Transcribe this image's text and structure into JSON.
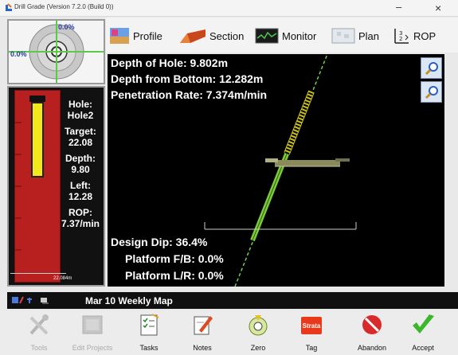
{
  "window": {
    "title": "Drill Grade (Version 7.2.0 (Build 0))",
    "minimize": "–",
    "close": "×"
  },
  "compass": {
    "top_label": "0.0%",
    "left_label": "0.0%"
  },
  "tabs": [
    {
      "label": "Profile",
      "icon": "profile-icon"
    },
    {
      "label": "Section",
      "icon": "section-icon"
    },
    {
      "label": "Monitor",
      "icon": "monitor-icon"
    },
    {
      "label": "Plan",
      "icon": "plan-icon"
    },
    {
      "label": "ROP",
      "icon": "rop-icon"
    }
  ],
  "side_stats": {
    "hole_label": "Hole:",
    "hole_value": "Hole2",
    "target_label": "Target:",
    "target_value": "22.08",
    "depth_label": "Depth:",
    "depth_value": "9.80",
    "left_label": "Left:",
    "left_value": "12.28",
    "rop_label": "ROP:",
    "rop_value": "7.37/min",
    "gauge_depth": "22.084m",
    "gauge_fill": 0.44
  },
  "view": {
    "depth_of_hole": "Depth of Hole: 9.802m",
    "depth_from_bottom": "Depth from Bottom: 12.282m",
    "penetration_rate": "Penetration Rate: 7.374m/min",
    "design_dip": "Design Dip: 36.4%",
    "platform_fb": "Platform F/B: 0.0%",
    "platform_lr": "Platform L/R: 0.0%"
  },
  "status": {
    "map_name": "Mar 10 Weekly Map"
  },
  "toolbar": [
    {
      "label": "Tools",
      "enabled": false
    },
    {
      "label": "Edit Projects",
      "enabled": false
    },
    {
      "label": "Tasks",
      "enabled": true
    },
    {
      "label": "Notes",
      "enabled": true
    },
    {
      "label": "Zero",
      "enabled": true
    },
    {
      "label": "Tag",
      "enabled": true,
      "icon_text": "Strata"
    },
    {
      "label": "Abandon",
      "enabled": true
    },
    {
      "label": "Accept",
      "enabled": true
    }
  ],
  "colors": {
    "gauge_red": "#b82020",
    "gauge_yellow": "#f2e81c",
    "drill_green": "#7ccc3a",
    "label_blue": "#223c9e"
  }
}
